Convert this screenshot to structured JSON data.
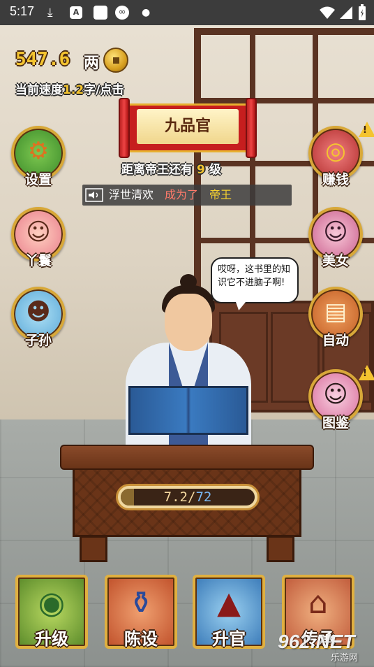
{
  "status_bar": {
    "time": "5:17",
    "icons": [
      "download-icon",
      "app-icon",
      "square-icon",
      "infinity-icon",
      "dot-icon",
      "wifi-icon",
      "signal-icon",
      "battery-icon"
    ]
  },
  "hud": {
    "money_amount": "547.6",
    "money_unit": "两",
    "speed_prefix": "当前速度",
    "speed_value": "1.2",
    "speed_suffix": "字/点击"
  },
  "rank": {
    "title": "九品官",
    "distance_prefix": "距离帝王还有",
    "distance_levels": "9",
    "distance_suffix": "级"
  },
  "announcement": {
    "player": "浮世清欢",
    "verb": "成为了",
    "rank": "帝王"
  },
  "left_menu": [
    {
      "label": "设置",
      "icon": "gear-icon"
    },
    {
      "label": "丫鬟",
      "icon": "maid-portrait-icon"
    },
    {
      "label": "子孙",
      "icon": "child-portrait-icon"
    }
  ],
  "right_menu": [
    {
      "label": "赚钱",
      "icon": "coins-icon",
      "alert": true
    },
    {
      "label": "美女",
      "icon": "beauty-portrait-icon",
      "alert": false
    },
    {
      "label": "自动",
      "icon": "book-icon",
      "alert": false
    },
    {
      "label": "图鉴",
      "icon": "lady-portrait-icon",
      "alert": true
    }
  ],
  "speech": {
    "text": "哎呀，这书里的知识它不进脑子啊!"
  },
  "progress": {
    "current": "7.2",
    "separator": "/",
    "max": "72",
    "fraction": 0.1
  },
  "bottom_buttons": [
    {
      "label": "升级",
      "icon": "jade-medallion-icon"
    },
    {
      "label": "陈设",
      "icon": "porcelain-vase-icon"
    },
    {
      "label": "升官",
      "icon": "official-hat-icon"
    },
    {
      "label": "传承",
      "icon": "pavilion-icon"
    }
  ],
  "watermark": {
    "brand": "962.NET",
    "site": "乐游网"
  },
  "colors": {
    "gold": "#f4c430",
    "scroll_red": "#c61e1e",
    "announce_verb": "#ff7a6a",
    "progress_max": "#7ab8f4"
  }
}
